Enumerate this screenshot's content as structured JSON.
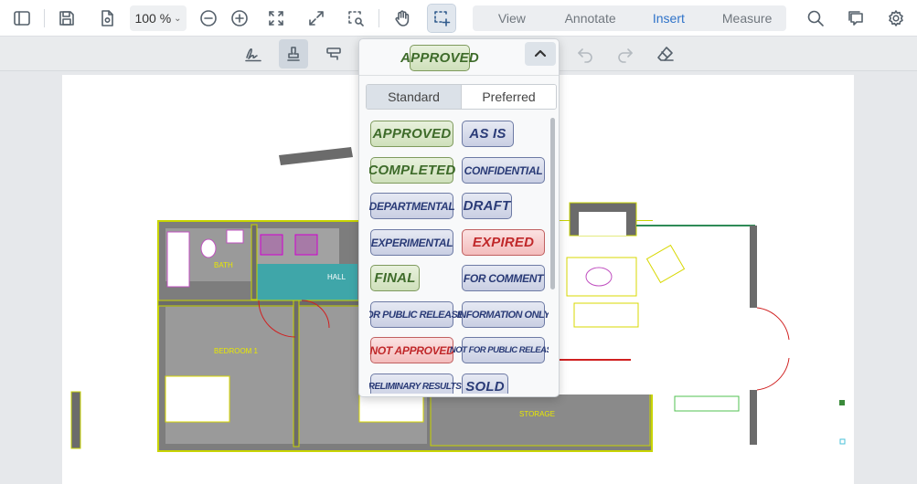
{
  "toolbar": {
    "zoom_value": "100 %",
    "modes": [
      {
        "label": "View",
        "selected": false
      },
      {
        "label": "Annotate",
        "selected": false
      },
      {
        "label": "Insert",
        "selected": true
      },
      {
        "label": "Measure",
        "selected": false
      }
    ]
  },
  "floorplan": {
    "rooms": [
      "BATH",
      "HALL",
      "BEDROOM 1",
      "STORAGE"
    ]
  },
  "stamp_panel": {
    "preview_label": "APPROVED",
    "tabs": [
      {
        "label": "Standard",
        "selected": true
      },
      {
        "label": "Preferred",
        "selected": false
      }
    ],
    "stamps": [
      {
        "label": "APPROVED",
        "color": "green"
      },
      {
        "label": "AS IS",
        "color": "blue"
      },
      {
        "label": "COMPLETED",
        "color": "green"
      },
      {
        "label": "CONFIDENTIAL",
        "color": "blue"
      },
      {
        "label": "DEPARTMENTAL",
        "color": "blue"
      },
      {
        "label": "DRAFT",
        "color": "blue"
      },
      {
        "label": "EXPERIMENTAL",
        "color": "blue"
      },
      {
        "label": "EXPIRED",
        "color": "red"
      },
      {
        "label": "FINAL",
        "color": "green"
      },
      {
        "label": "FOR COMMENT",
        "color": "blue"
      },
      {
        "label": "FOR PUBLIC RELEASE",
        "color": "blue"
      },
      {
        "label": "INFORMATION ONLY",
        "color": "blue"
      },
      {
        "label": "NOT APPROVED",
        "color": "red"
      },
      {
        "label": "NOT FOR PUBLIC RELEASE",
        "color": "blue"
      },
      {
        "label": "PRELIMINARY RESULTS",
        "color": "blue"
      },
      {
        "label": "SOLD",
        "color": "blue"
      }
    ]
  },
  "colors": {
    "accent": "#2f73c9",
    "stamp_green_text": "#3e6b2a",
    "stamp_blue_text": "#2a3b77",
    "stamp_red_text": "#c0282a",
    "plan_wall": "#6b6b6b",
    "plan_outline": "#c8d400",
    "plan_teal": "#3fa6a9"
  }
}
